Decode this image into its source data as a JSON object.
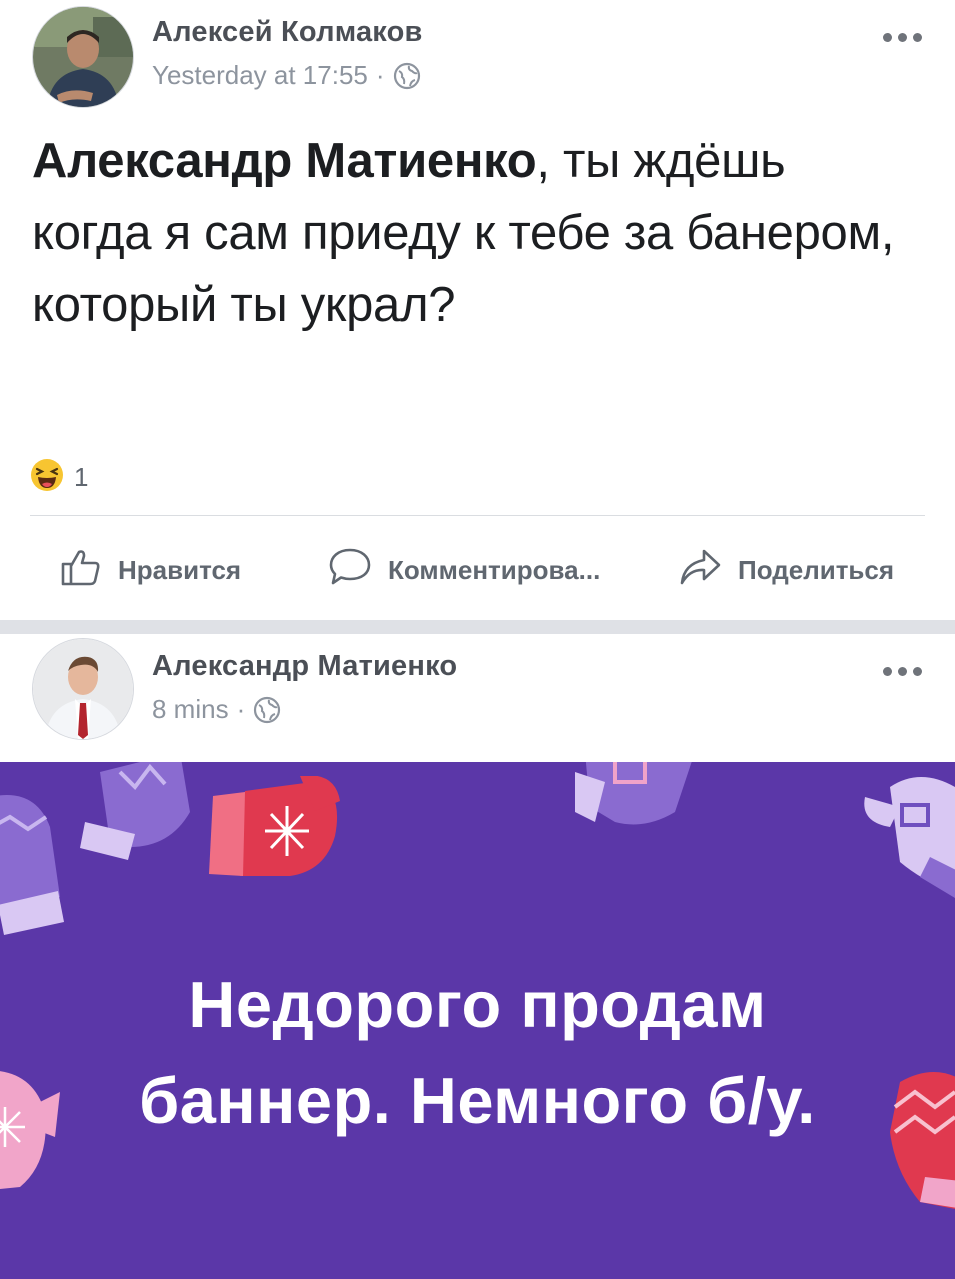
{
  "post1": {
    "author": "Алексей Колмаков",
    "timestamp": "Yesterday at 17:55",
    "separator": "·",
    "privacy_icon": "globe-icon",
    "text_mention": "Александр Матиенко",
    "text_rest": ", ты ждёшь когда я сам приеду к тебе за банером, который ты украл?",
    "reaction_icon": "haha-emoji-icon",
    "reaction_count": "1",
    "actions": {
      "like": "Нравится",
      "comment": "Комментирова...",
      "share": "Поделиться"
    }
  },
  "post2": {
    "author": "Александр Матиенко",
    "timestamp": "8 mins",
    "separator": "·",
    "privacy_icon": "globe-icon",
    "banner_text": "Недорого продам баннер. Немного б/у.",
    "banner_color": "#5b37a8"
  },
  "colors": {
    "name": "#4b4f56",
    "meta": "#8d949e",
    "action": "#606770",
    "divider": "#dfe1e6"
  }
}
